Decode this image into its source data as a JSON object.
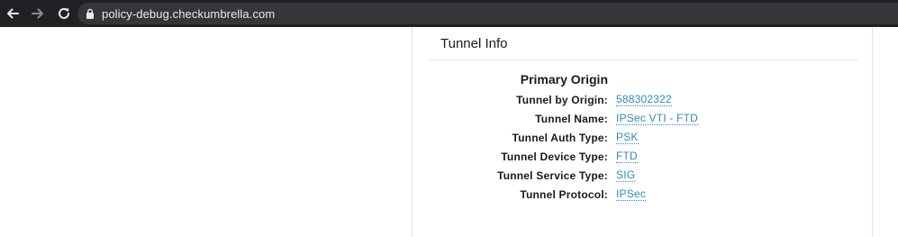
{
  "browser": {
    "url": "policy-debug.checkumbrella.com",
    "icons": [
      "back-arrow-icon",
      "forward-arrow-icon",
      "reload-icon",
      "lock-icon"
    ],
    "colors": {
      "toolbar": "#202124",
      "omnibox": "#35363a",
      "url_text": "#e8eaed"
    }
  },
  "card": {
    "title": "Tunnel Info",
    "section_title": "Primary Origin",
    "rows": [
      {
        "label": "Tunnel by Origin:",
        "value": "588302322"
      },
      {
        "label": "Tunnel Name:",
        "value": "IPSec VTI - FTD"
      },
      {
        "label": "Tunnel Auth Type:",
        "value": "PSK"
      },
      {
        "label": "Tunnel Device Type:",
        "value": "FTD"
      },
      {
        "label": "Tunnel Service Type:",
        "value": "SIG"
      },
      {
        "label": "Tunnel Protocol:",
        "value": "IPSec"
      }
    ],
    "colors": {
      "link": "#2e8cb8",
      "text": "#1a1a1a"
    }
  }
}
